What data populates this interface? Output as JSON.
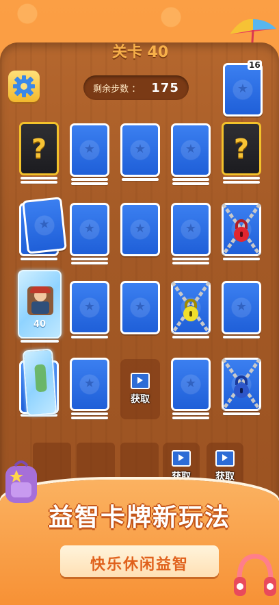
{
  "header": {
    "level_title": "关卡 40",
    "steps_label": "剩余步数 ：",
    "steps_value": "175",
    "deck_count": "16"
  },
  "board": {
    "mystery_symbol": "?",
    "frozen_count": "40",
    "acquire_label": "获取"
  },
  "slots": {
    "acquire_label_1": "获取",
    "acquire_label_2": "获取"
  },
  "promo": {
    "headline": "益智卡牌新玩法",
    "subline": "快乐休闲益智"
  },
  "colors": {
    "background": "#f88c33",
    "card_blue": "#1f5fd8",
    "mystery_gold": "#f3c22b",
    "board_wood": "#a45a26"
  }
}
